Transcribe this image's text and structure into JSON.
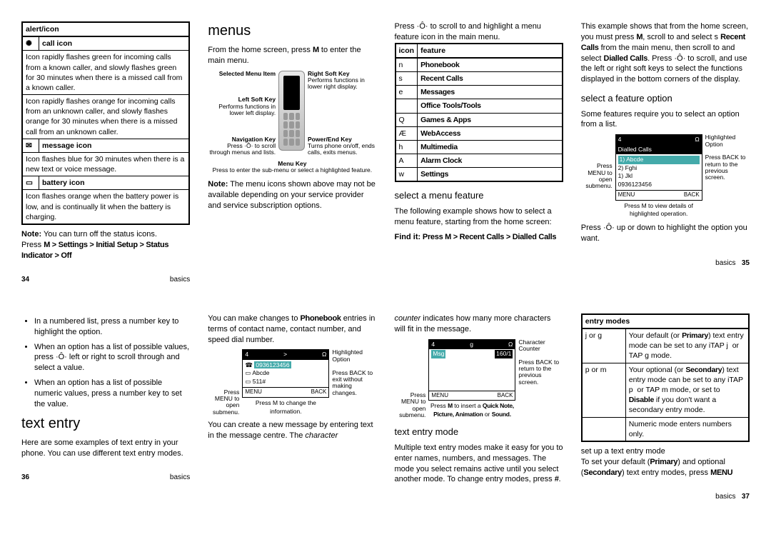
{
  "p34": {
    "alert_hdr": "alert/icon",
    "call_icon_hdr": "call icon",
    "call_icon_body": "Icon rapidly flashes green for incoming calls from a known caller, and slowly flashes green for 30 minutes when there is a missed call from a known caller.",
    "call_icon_body2": "Icon rapidly flashes orange for incoming calls from an unknown caller, and slowly flashes orange for 30 minutes when there is a missed call from an unknown caller.",
    "msg_hdr": "message icon",
    "msg_body": "Icon flashes blue for 30 minutes when there is a new text or voice message.",
    "bat_hdr": "battery icon",
    "bat_body": "Icon flashes orange when the battery power is low, and is continually lit when the battery is charging.",
    "note_lead": "Note:",
    "note_body": " You can turn off the status icons.",
    "path_lead": "Press ",
    "path": "M > Settings > Initial Setup > Status Indicator > Off",
    "foot": "basics",
    "pn": "34"
  },
  "p35a": {
    "title": "menus",
    "intro_a": "From the home screen, press ",
    "intro_b": " to enter the main menu.",
    "ann_sel": "Selected Menu Item",
    "ann_lsk": "Left Soft Key",
    "ann_lsk2": "Performs functions in lower left display.",
    "ann_nav": "Navigation Key",
    "ann_nav2": "Press ·Ô· to scroll through menus and lists.",
    "ann_menu": "Menu Key",
    "ann_menu2": "Press to enter the sub-menu or select a highlighted feature.",
    "ann_rsk": "Right Soft Key",
    "ann_rsk2": "Performs functions in lower right display.",
    "ann_pwr": "Power/End Key",
    "ann_pwr2": "Turns phone on/off, ends calls, exits menus.",
    "note_lead": "Note:",
    "note_body": " The menu icons shown above may not be available depending on your service provider and service subscription options."
  },
  "p35b": {
    "intro": "Press ·Ô· to scroll to and highlight a menu feature icon in the main menu.",
    "th1": "icon",
    "th2": "feature",
    "rows": [
      {
        "i": "n",
        "f": "Phonebook"
      },
      {
        "i": "s",
        "f": "Recent Calls"
      },
      {
        "i": "e",
        "f": "Messages"
      },
      {
        "i": "",
        "f": "Office Tools/Tools"
      },
      {
        "i": "Q",
        "f": "Games & Apps"
      },
      {
        "i": "Æ",
        "f": "WebAccess"
      },
      {
        "i": "h",
        "f": "Multimedia"
      },
      {
        "i": "A",
        "f": "Alarm Clock"
      },
      {
        "i": "w",
        "f": "Settings"
      }
    ],
    "h2": "select a menu feature",
    "body": "The following example shows how to select a menu feature, starting from the home screen:",
    "find_lead": "Find it:",
    "find": " Press M > Recent Calls > Dialled Calls"
  },
  "p35c": {
    "body1": "This example shows that from the home screen, you must press M, scroll to and select s Recent Calls from the main menu, then scroll to and select Dialled Calls. Press ·Ô· to scroll, and use the left or right soft keys to select the functions displayed in the bottom corners of the display.",
    "h2": "select a feature option",
    "body2": "Some features require you to select an option from a list.",
    "scr_title": "Dialled Calls",
    "scr_r1": "1) Abcde",
    "scr_r2": "2) Fghi",
    "scr_r3": "1) Jkl",
    "scr_r4": "0936123456",
    "scr_menu": "MENU",
    "scr_back": "BACK",
    "ann_hl": "Highlighted Option",
    "ann_menuopen": "Press MENU to open submenu.",
    "ann_back": "Press BACK to return to the previous screen.",
    "ann_bot": "Press M to view details of highlighted operation.",
    "body3": "Press ·Ô· up or down to highlight the option you want.",
    "foot": "basics",
    "pn": "35"
  },
  "p36a": {
    "b1": "In a numbered list, press a number key to highlight the option.",
    "b2": "When an option has a list of possible values, press ·Ô· left or right to scroll through and select a value.",
    "b3": "When an option has a list of possible numeric values, press a number key to set the value.",
    "title": "text entry",
    "body": "Here are some examples of text entry in your phone. You can use different text entry modes.",
    "foot": "basics",
    "pn": "36"
  },
  "p36b": {
    "body1": "You can make changes to Phonebook entries in terms of contact name, contact number, and speed dial number.",
    "scr_top": "4        >        Ω",
    "scr_r1": "0936123456",
    "scr_r2": "Abcde",
    "scr_r3": "511#",
    "scr_menu": "MENU",
    "scr_back": "BACK",
    "ann_menuopen": "Press MENU to open submenu.",
    "ann_hl": "Highlighted Option",
    "ann_back": "Press BACK to exit without making changes.",
    "ann_bot": "Press M to change the information.",
    "body2": "You can create a new message by entering text in the message centre. The character"
  },
  "p37a": {
    "body1a": "counter",
    "body1b": " indicates how many more characters will fit in the message.",
    "scr_lbl": "Msg",
    "scr_cnt": "160/1",
    "ann_cc": "Character Counter",
    "ann_menuopen": "Press MENU to open submenu.",
    "ann_back": "Press BACK to return to the previous screen.",
    "ann_bot": "Press M to insert a Quick Note, Picture, Animation or Sound.",
    "h2": "text entry mode",
    "body2": "Multiple text entry modes make it easy for you to enter names, numbers, and messages. The mode you select remains active until you select another mode. To change entry modes, press #."
  },
  "p37b": {
    "th": "entry modes",
    "r1a": "j  or g",
    "r1b": "Your default (or Primary) text entry mode can be set to any iTAP j  or TAP g mode.",
    "r2a": "p  or m",
    "r2b": "Your optional (or Secondary) text entry mode can be set to any iTAP p  or TAP m mode, or set to Disable if you don't want a secondary entry mode.",
    "r3a": "",
    "r3b": "Numeric mode enters numbers only.",
    "body1": "set up a text entry mode",
    "body2": "To set your default (Primary) and optional (Secondary) text entry modes, press MENU",
    "foot": "basics",
    "pn": "37"
  }
}
